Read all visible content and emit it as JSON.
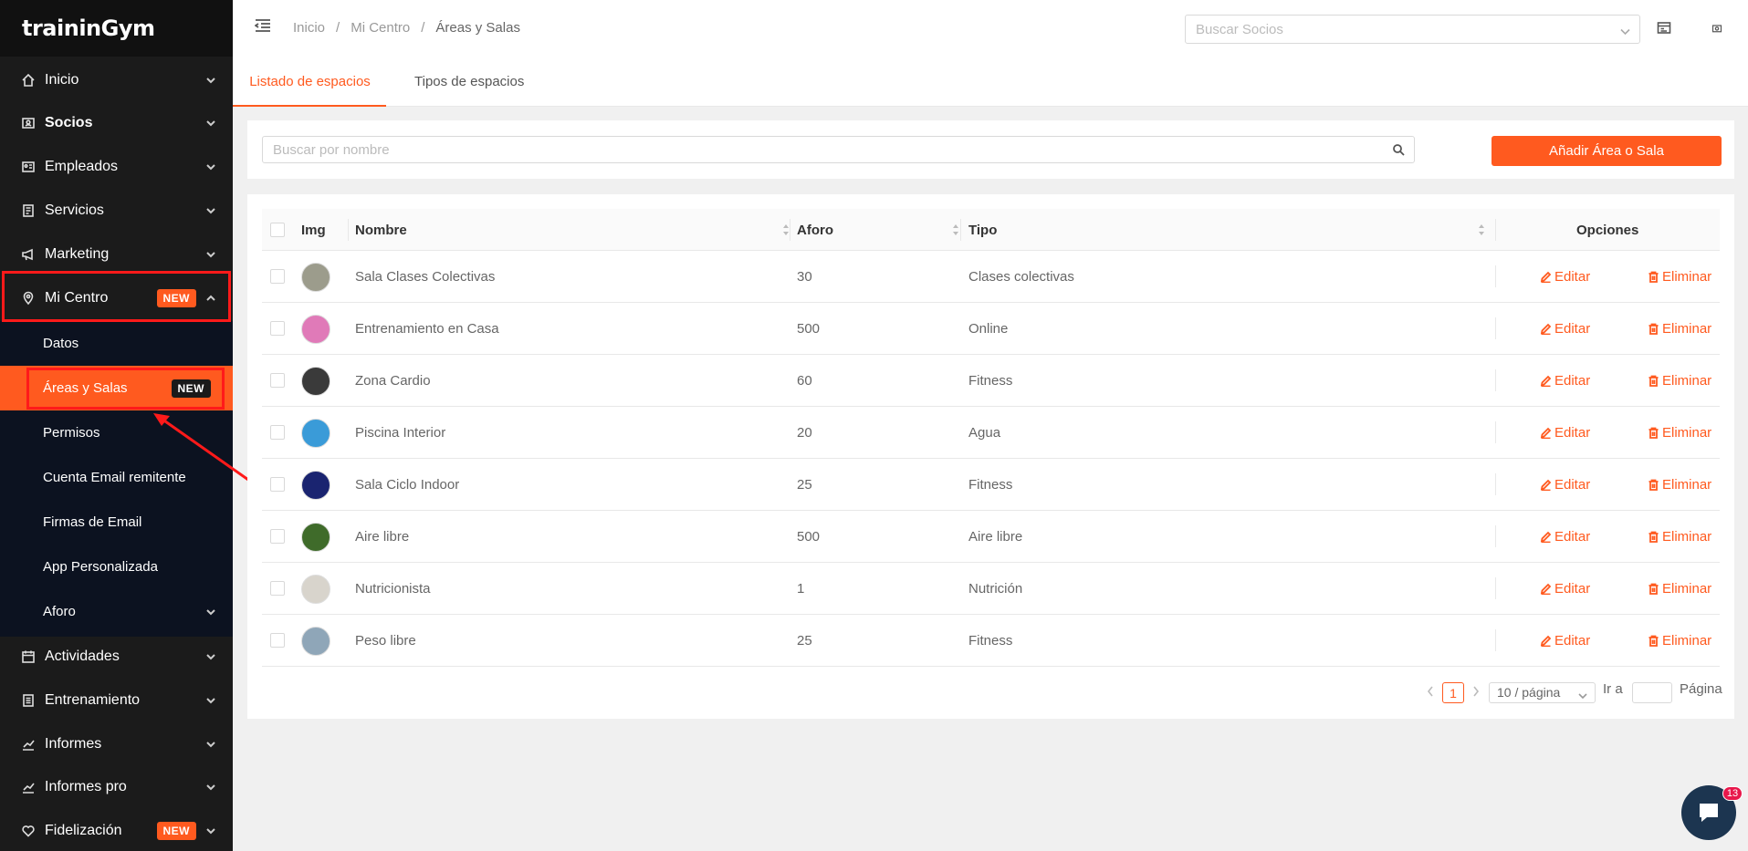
{
  "app": {
    "logo": "traininGym"
  },
  "sidebar": {
    "items": [
      {
        "label": "Inicio",
        "icon": "home-icon"
      },
      {
        "label": "Socios",
        "icon": "id-card-icon"
      },
      {
        "label": "Empleados",
        "icon": "id-badge-icon"
      },
      {
        "label": "Servicios",
        "icon": "receipt-icon"
      },
      {
        "label": "Marketing",
        "icon": "megaphone-icon"
      },
      {
        "label": "Mi Centro",
        "icon": "location-pin-icon",
        "badge": "NEW",
        "expanded": true
      },
      {
        "label": "Actividades",
        "icon": "calendar-icon"
      },
      {
        "label": "Entrenamiento",
        "icon": "clipboard-icon"
      },
      {
        "label": "Informes",
        "icon": "line-chart-icon"
      },
      {
        "label": "Informes pro",
        "icon": "line-chart-icon"
      },
      {
        "label": "Fidelización",
        "icon": "heart-icon",
        "badge": "NEW"
      }
    ],
    "sub_items": [
      {
        "label": "Datos"
      },
      {
        "label": "Áreas y Salas",
        "badge": "NEW",
        "active": true
      },
      {
        "label": "Permisos"
      },
      {
        "label": "Cuenta Email remitente"
      },
      {
        "label": "Firmas de Email"
      },
      {
        "label": "App Personalizada"
      },
      {
        "label": "Aforo"
      }
    ]
  },
  "header": {
    "breadcrumb": [
      "Inicio",
      "/",
      "Mi Centro",
      "/",
      "Áreas y Salas"
    ],
    "member_search_placeholder": "Buscar Socios"
  },
  "tabs": [
    {
      "label": "Listado de espacios",
      "active": true
    },
    {
      "label": "Tipos de espacios",
      "active": false
    }
  ],
  "search": {
    "placeholder": "Buscar por nombre",
    "add_button": "Añadir Área o Sala"
  },
  "table": {
    "columns": [
      "Img",
      "Nombre",
      "Aforo",
      "Tipo",
      "Opciones"
    ],
    "edit_label": "Editar",
    "delete_label": "Eliminar",
    "rows": [
      {
        "name": "Sala Clases Colectivas",
        "aforo": "30",
        "tipo": "Clases colectivas",
        "thumb": "#9c9c8c"
      },
      {
        "name": "Entrenamiento en Casa",
        "aforo": "500",
        "tipo": "Online",
        "thumb": "#e07ab8"
      },
      {
        "name": "Zona Cardio",
        "aforo": "60",
        "tipo": "Fitness",
        "thumb": "#3a3a3a"
      },
      {
        "name": "Piscina Interior",
        "aforo": "20",
        "tipo": "Agua",
        "thumb": "#3a9bd8"
      },
      {
        "name": "Sala Ciclo Indoor",
        "aforo": "25",
        "tipo": "Fitness",
        "thumb": "#1a2470"
      },
      {
        "name": "Aire libre",
        "aforo": "500",
        "tipo": "Aire libre",
        "thumb": "#3f6b2a"
      },
      {
        "name": "Nutricionista",
        "aforo": "1",
        "tipo": "Nutrición",
        "thumb": "#d8d4cc"
      },
      {
        "name": "Peso libre",
        "aforo": "25",
        "tipo": "Fitness",
        "thumb": "#8fa6b8"
      }
    ]
  },
  "pagination": {
    "current_page": "1",
    "page_size": "10 / página",
    "goto_label": "Ir a",
    "page_label": "Página"
  },
  "chat": {
    "unread": "13"
  },
  "colors": {
    "accent": "#ff5a1f",
    "sidebar": "#1b1b1b",
    "submenu": "#0c1220",
    "annotation": "#ff1a1a"
  }
}
